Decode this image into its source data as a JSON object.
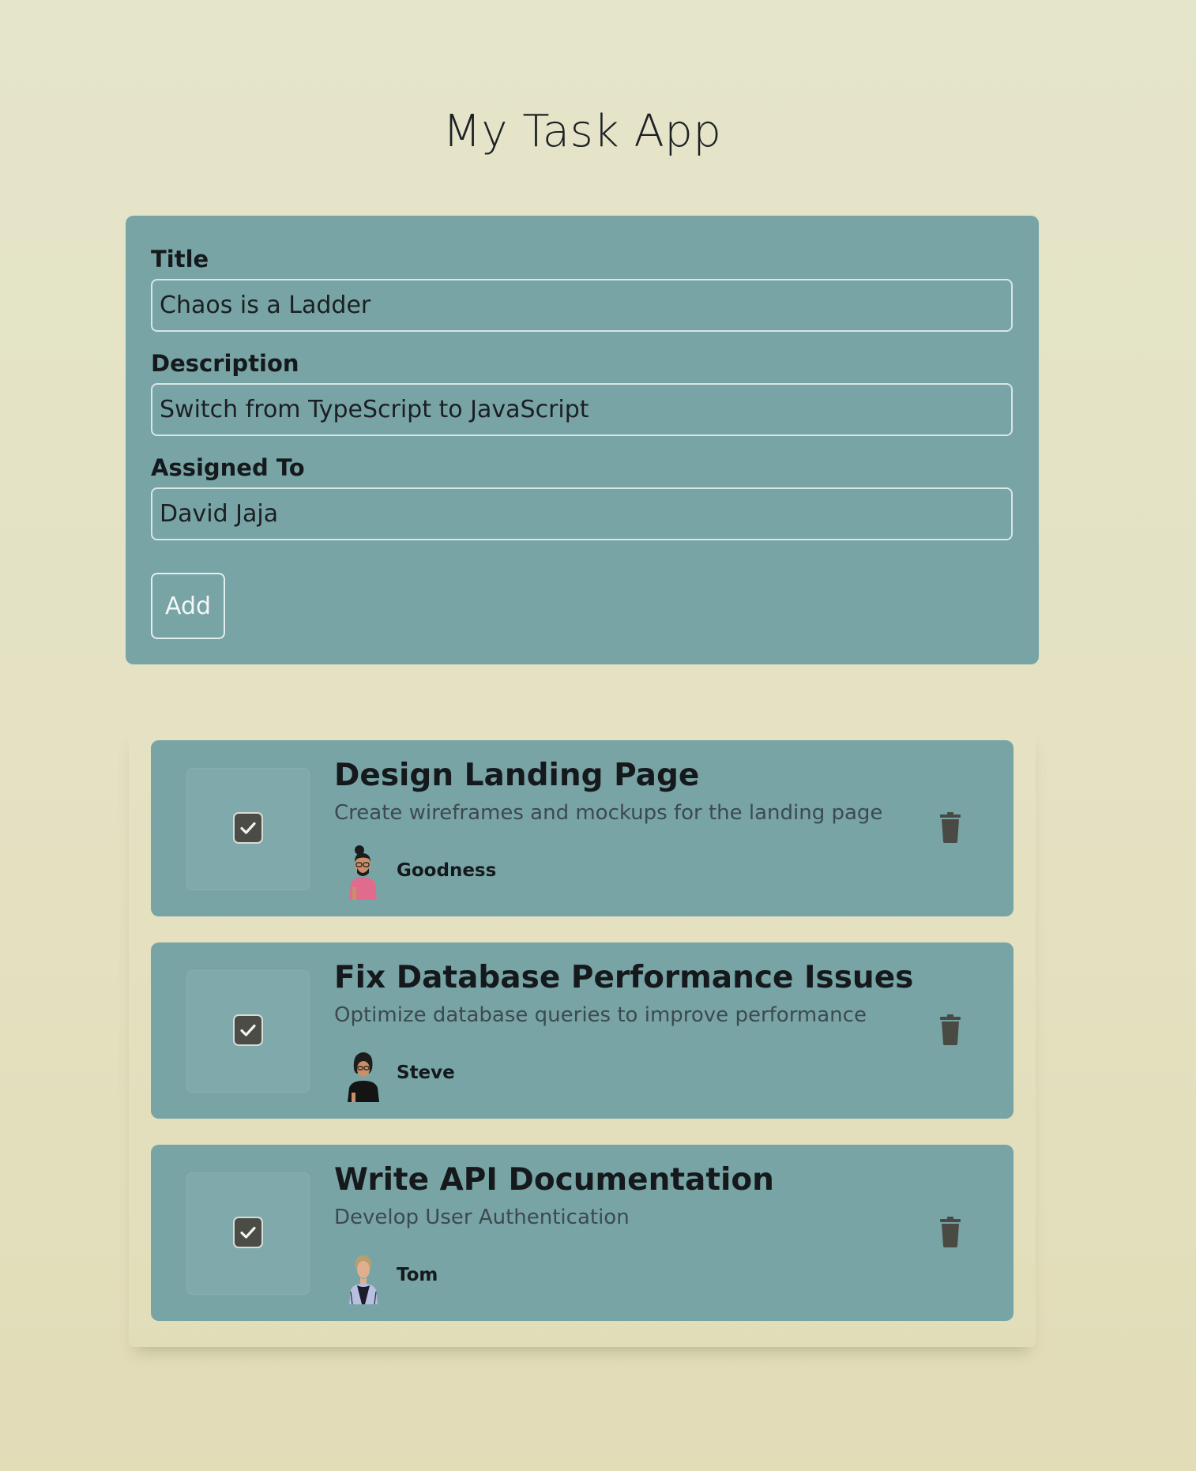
{
  "header": {
    "title": "My Task App"
  },
  "form": {
    "title_label": "Title",
    "title_value": "Chaos is a Ladder",
    "description_label": "Description",
    "description_value": "Switch from TypeScript to JavaScript",
    "assigned_label": "Assigned To",
    "assigned_value": "David Jaja",
    "add_label": "Add"
  },
  "tasks": [
    {
      "title": "Design Landing Page",
      "description": "Create wireframes and mockups for the landing page",
      "assignee": "Goodness",
      "completed": true
    },
    {
      "title": "Fix Database Performance Issues",
      "description": "Optimize database queries to improve performance",
      "assignee": "Steve",
      "completed": true
    },
    {
      "title": "Write API Documentation",
      "description": "Develop User Authentication",
      "assignee": "Tom",
      "completed": true
    }
  ],
  "colors": {
    "background": "#e4e1c1",
    "panel": "#78a4a6",
    "checkbox": "#4c4c46",
    "trash": "#4a4a44"
  }
}
